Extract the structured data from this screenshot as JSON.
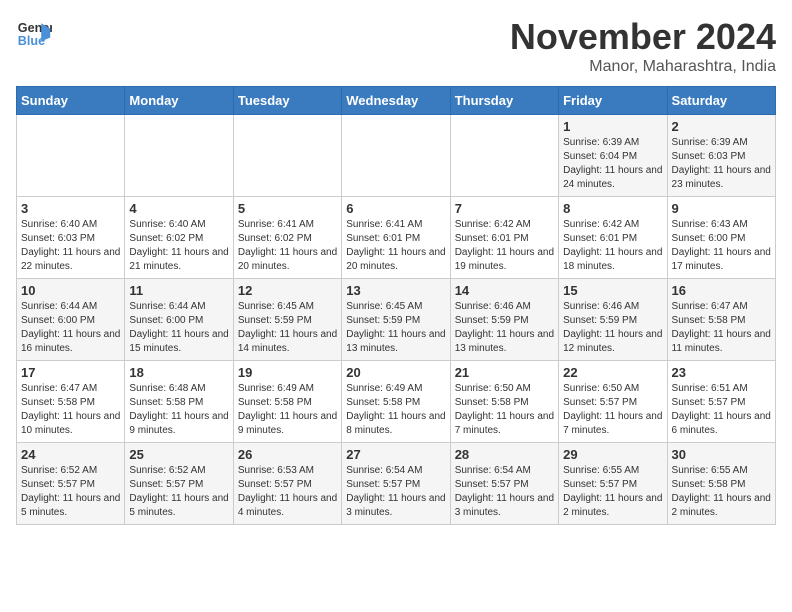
{
  "logo": {
    "line1": "General",
    "line2": "Blue"
  },
  "header": {
    "title": "November 2024",
    "subtitle": "Manor, Maharashtra, India"
  },
  "weekdays": [
    "Sunday",
    "Monday",
    "Tuesday",
    "Wednesday",
    "Thursday",
    "Friday",
    "Saturday"
  ],
  "weeks": [
    [
      {
        "day": "",
        "info": ""
      },
      {
        "day": "",
        "info": ""
      },
      {
        "day": "",
        "info": ""
      },
      {
        "day": "",
        "info": ""
      },
      {
        "day": "",
        "info": ""
      },
      {
        "day": "1",
        "info": "Sunrise: 6:39 AM\nSunset: 6:04 PM\nDaylight: 11 hours and 24 minutes."
      },
      {
        "day": "2",
        "info": "Sunrise: 6:39 AM\nSunset: 6:03 PM\nDaylight: 11 hours and 23 minutes."
      }
    ],
    [
      {
        "day": "3",
        "info": "Sunrise: 6:40 AM\nSunset: 6:03 PM\nDaylight: 11 hours and 22 minutes."
      },
      {
        "day": "4",
        "info": "Sunrise: 6:40 AM\nSunset: 6:02 PM\nDaylight: 11 hours and 21 minutes."
      },
      {
        "day": "5",
        "info": "Sunrise: 6:41 AM\nSunset: 6:02 PM\nDaylight: 11 hours and 20 minutes."
      },
      {
        "day": "6",
        "info": "Sunrise: 6:41 AM\nSunset: 6:01 PM\nDaylight: 11 hours and 20 minutes."
      },
      {
        "day": "7",
        "info": "Sunrise: 6:42 AM\nSunset: 6:01 PM\nDaylight: 11 hours and 19 minutes."
      },
      {
        "day": "8",
        "info": "Sunrise: 6:42 AM\nSunset: 6:01 PM\nDaylight: 11 hours and 18 minutes."
      },
      {
        "day": "9",
        "info": "Sunrise: 6:43 AM\nSunset: 6:00 PM\nDaylight: 11 hours and 17 minutes."
      }
    ],
    [
      {
        "day": "10",
        "info": "Sunrise: 6:44 AM\nSunset: 6:00 PM\nDaylight: 11 hours and 16 minutes."
      },
      {
        "day": "11",
        "info": "Sunrise: 6:44 AM\nSunset: 6:00 PM\nDaylight: 11 hours and 15 minutes."
      },
      {
        "day": "12",
        "info": "Sunrise: 6:45 AM\nSunset: 5:59 PM\nDaylight: 11 hours and 14 minutes."
      },
      {
        "day": "13",
        "info": "Sunrise: 6:45 AM\nSunset: 5:59 PM\nDaylight: 11 hours and 13 minutes."
      },
      {
        "day": "14",
        "info": "Sunrise: 6:46 AM\nSunset: 5:59 PM\nDaylight: 11 hours and 13 minutes."
      },
      {
        "day": "15",
        "info": "Sunrise: 6:46 AM\nSunset: 5:59 PM\nDaylight: 11 hours and 12 minutes."
      },
      {
        "day": "16",
        "info": "Sunrise: 6:47 AM\nSunset: 5:58 PM\nDaylight: 11 hours and 11 minutes."
      }
    ],
    [
      {
        "day": "17",
        "info": "Sunrise: 6:47 AM\nSunset: 5:58 PM\nDaylight: 11 hours and 10 minutes."
      },
      {
        "day": "18",
        "info": "Sunrise: 6:48 AM\nSunset: 5:58 PM\nDaylight: 11 hours and 9 minutes."
      },
      {
        "day": "19",
        "info": "Sunrise: 6:49 AM\nSunset: 5:58 PM\nDaylight: 11 hours and 9 minutes."
      },
      {
        "day": "20",
        "info": "Sunrise: 6:49 AM\nSunset: 5:58 PM\nDaylight: 11 hours and 8 minutes."
      },
      {
        "day": "21",
        "info": "Sunrise: 6:50 AM\nSunset: 5:58 PM\nDaylight: 11 hours and 7 minutes."
      },
      {
        "day": "22",
        "info": "Sunrise: 6:50 AM\nSunset: 5:57 PM\nDaylight: 11 hours and 7 minutes."
      },
      {
        "day": "23",
        "info": "Sunrise: 6:51 AM\nSunset: 5:57 PM\nDaylight: 11 hours and 6 minutes."
      }
    ],
    [
      {
        "day": "24",
        "info": "Sunrise: 6:52 AM\nSunset: 5:57 PM\nDaylight: 11 hours and 5 minutes."
      },
      {
        "day": "25",
        "info": "Sunrise: 6:52 AM\nSunset: 5:57 PM\nDaylight: 11 hours and 5 minutes."
      },
      {
        "day": "26",
        "info": "Sunrise: 6:53 AM\nSunset: 5:57 PM\nDaylight: 11 hours and 4 minutes."
      },
      {
        "day": "27",
        "info": "Sunrise: 6:54 AM\nSunset: 5:57 PM\nDaylight: 11 hours and 3 minutes."
      },
      {
        "day": "28",
        "info": "Sunrise: 6:54 AM\nSunset: 5:57 PM\nDaylight: 11 hours and 3 minutes."
      },
      {
        "day": "29",
        "info": "Sunrise: 6:55 AM\nSunset: 5:57 PM\nDaylight: 11 hours and 2 minutes."
      },
      {
        "day": "30",
        "info": "Sunrise: 6:55 AM\nSunset: 5:58 PM\nDaylight: 11 hours and 2 minutes."
      }
    ]
  ]
}
